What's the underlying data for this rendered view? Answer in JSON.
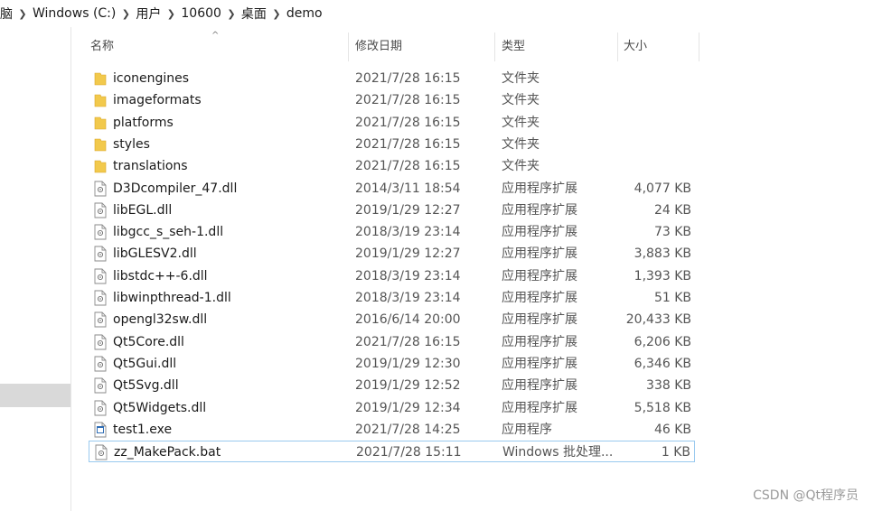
{
  "breadcrumb": [
    "脑",
    "Windows (C:)",
    "用户",
    "10600",
    "桌面",
    "demo"
  ],
  "columns": {
    "name": "名称",
    "date": "修改日期",
    "type": "类型",
    "size": "大小"
  },
  "files": [
    {
      "name": "iconengines",
      "date": "2021/7/28 16:15",
      "type": "文件夹",
      "size": "",
      "icon": "folder-icon"
    },
    {
      "name": "imageformats",
      "date": "2021/7/28 16:15",
      "type": "文件夹",
      "size": "",
      "icon": "folder-icon"
    },
    {
      "name": "platforms",
      "date": "2021/7/28 16:15",
      "type": "文件夹",
      "size": "",
      "icon": "folder-icon"
    },
    {
      "name": "styles",
      "date": "2021/7/28 16:15",
      "type": "文件夹",
      "size": "",
      "icon": "folder-icon"
    },
    {
      "name": "translations",
      "date": "2021/7/28 16:15",
      "type": "文件夹",
      "size": "",
      "icon": "folder-icon"
    },
    {
      "name": "D3Dcompiler_47.dll",
      "date": "2014/3/11 18:54",
      "type": "应用程序扩展",
      "size": "4,077 KB",
      "icon": "dll-file-icon"
    },
    {
      "name": "libEGL.dll",
      "date": "2019/1/29 12:27",
      "type": "应用程序扩展",
      "size": "24 KB",
      "icon": "dll-file-icon"
    },
    {
      "name": "libgcc_s_seh-1.dll",
      "date": "2018/3/19 23:14",
      "type": "应用程序扩展",
      "size": "73 KB",
      "icon": "dll-file-icon"
    },
    {
      "name": "libGLESV2.dll",
      "date": "2019/1/29 12:27",
      "type": "应用程序扩展",
      "size": "3,883 KB",
      "icon": "dll-file-icon"
    },
    {
      "name": "libstdc++-6.dll",
      "date": "2018/3/19 23:14",
      "type": "应用程序扩展",
      "size": "1,393 KB",
      "icon": "dll-file-icon"
    },
    {
      "name": "libwinpthread-1.dll",
      "date": "2018/3/19 23:14",
      "type": "应用程序扩展",
      "size": "51 KB",
      "icon": "dll-file-icon"
    },
    {
      "name": "opengl32sw.dll",
      "date": "2016/6/14 20:00",
      "type": "应用程序扩展",
      "size": "20,433 KB",
      "icon": "dll-file-icon"
    },
    {
      "name": "Qt5Core.dll",
      "date": "2021/7/28 16:15",
      "type": "应用程序扩展",
      "size": "6,206 KB",
      "icon": "dll-file-icon"
    },
    {
      "name": "Qt5Gui.dll",
      "date": "2019/1/29 12:30",
      "type": "应用程序扩展",
      "size": "6,346 KB",
      "icon": "dll-file-icon"
    },
    {
      "name": "Qt5Svg.dll",
      "date": "2019/1/29 12:52",
      "type": "应用程序扩展",
      "size": "338 KB",
      "icon": "dll-file-icon"
    },
    {
      "name": "Qt5Widgets.dll",
      "date": "2019/1/29 12:34",
      "type": "应用程序扩展",
      "size": "5,518 KB",
      "icon": "dll-file-icon"
    },
    {
      "name": "test1.exe",
      "date": "2021/7/28 14:25",
      "type": "应用程序",
      "size": "46 KB",
      "icon": "exe-file-icon"
    },
    {
      "name": "zz_MakePack.bat",
      "date": "2021/7/28 15:11",
      "type": "Windows 批处理...",
      "size": "1 KB",
      "icon": "bat-file-icon",
      "selected": true
    }
  ],
  "watermark": "CSDN @Qt程序员",
  "colors": {
    "folder": "#f2c94c",
    "selection_border": "#99c9ef",
    "sidebar_selection": "#d9d9d9"
  }
}
